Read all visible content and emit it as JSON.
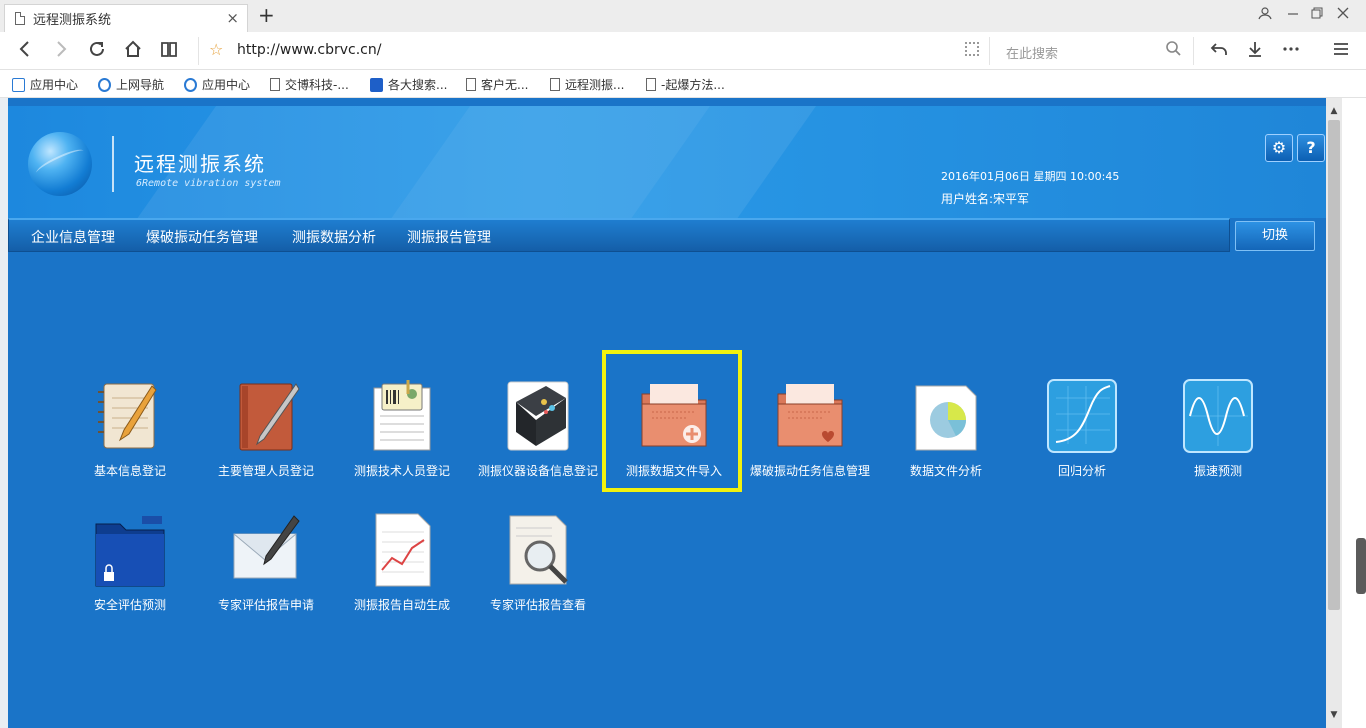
{
  "browser": {
    "tab_title": "远程测振系统",
    "tab_close": "×",
    "new_tab": "+",
    "url": "http://www.cbrvc.cn/",
    "search_placeholder": "在此搜索",
    "bookmarks": [
      {
        "label": "应用中心",
        "icon": "bag-icon"
      },
      {
        "label": "上网导航",
        "icon": "ie-icon"
      },
      {
        "label": "应用中心",
        "icon": "circle-icon"
      },
      {
        "label": "交博科技-...",
        "icon": "document-icon"
      },
      {
        "label": "各大搜索...",
        "icon": "paw-icon"
      },
      {
        "label": "客户无...",
        "icon": "document-icon"
      },
      {
        "label": "远程测振...",
        "icon": "document-icon"
      },
      {
        "label": "-起爆方法...",
        "icon": "document-icon"
      }
    ]
  },
  "header": {
    "title": "远程测振系统",
    "subtitle": "6Remote vibration system",
    "datetime": "2016年01月06日 星期四 10:00:45",
    "user": "用户姓名:宋平军",
    "settings_label": "⚙",
    "help_label": "?"
  },
  "menu": {
    "items": [
      "企业信息管理",
      "爆破振动任务管理",
      "测振数据分析",
      "测振报告管理"
    ],
    "switch_label": "切换"
  },
  "grid": {
    "items": [
      {
        "label": "基本信息登记",
        "icon": "notebook-pencil-icon"
      },
      {
        "label": "主要管理人员登记",
        "icon": "book-pen-icon"
      },
      {
        "label": "测振技术人员登记",
        "icon": "id-card-form-icon"
      },
      {
        "label": "测振仪器设备信息登记",
        "icon": "device-icon"
      },
      {
        "label": "测振数据文件导入",
        "icon": "folder-plus-icon",
        "highlighted": true
      },
      {
        "label": "爆破振动任务信息管理",
        "icon": "folder-heart-icon"
      },
      {
        "label": "数据文件分析",
        "icon": "pie-document-icon"
      },
      {
        "label": "回归分析",
        "icon": "curve-chart-icon"
      },
      {
        "label": "振速预测",
        "icon": "wave-chart-icon"
      },
      {
        "label": "安全评估预测",
        "icon": "locked-folder-icon"
      },
      {
        "label": "专家评估报告申请",
        "icon": "envelope-pen-icon"
      },
      {
        "label": "测振报告自动生成",
        "icon": "report-chart-icon"
      },
      {
        "label": "专家评估报告查看",
        "icon": "magnifier-document-icon"
      }
    ]
  },
  "colors": {
    "page_bg": "#1a74c8",
    "header_bg": "#2a9ae8",
    "highlight": "#f2f20e"
  }
}
